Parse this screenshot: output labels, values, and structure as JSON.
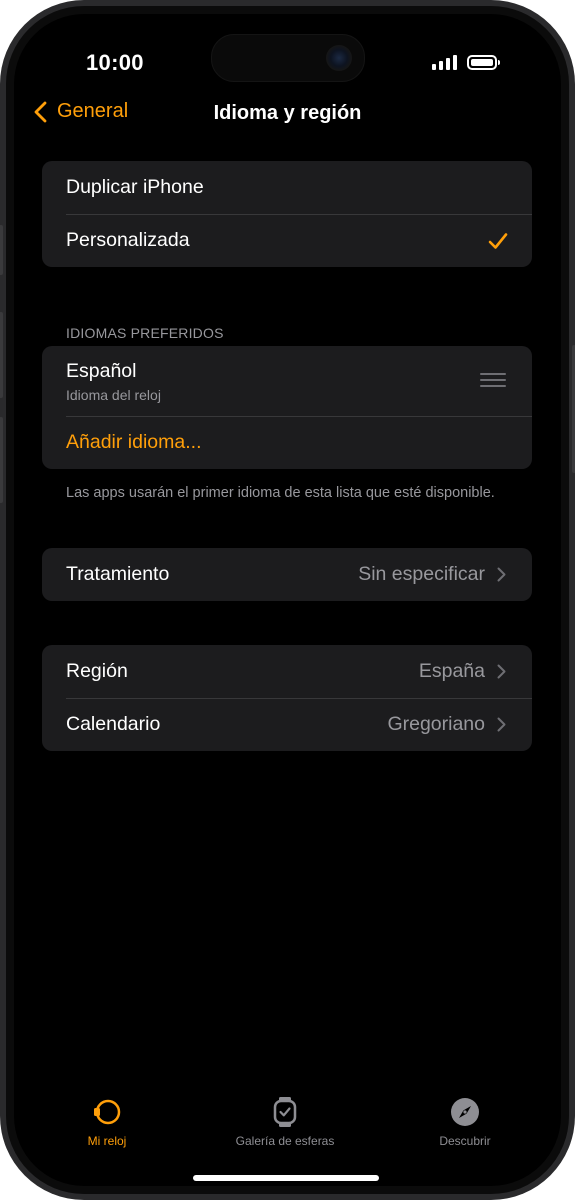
{
  "status_bar": {
    "time": "10:00"
  },
  "nav": {
    "back_label": "General",
    "title": "Idioma y región"
  },
  "language_mode": {
    "items": [
      {
        "label": "Duplicar iPhone",
        "selected": false
      },
      {
        "label": "Personalizada",
        "selected": true
      }
    ]
  },
  "preferred_languages": {
    "header": "IDIOMAS PREFERIDOS",
    "language": {
      "name": "Español",
      "subtitle": "Idioma del reloj"
    },
    "add_label": "Añadir idioma...",
    "footer": "Las apps usarán el primer idioma de esta lista que esté disponible."
  },
  "treatment": {
    "label": "Tratamiento",
    "value": "Sin especificar"
  },
  "region_group": {
    "region": {
      "label": "Región",
      "value": "España"
    },
    "calendar": {
      "label": "Calendario",
      "value": "Gregoriano"
    }
  },
  "tab_bar": {
    "tabs": [
      {
        "label": "Mi reloj",
        "icon": "watch-side-icon",
        "active": true
      },
      {
        "label": "Galería de esferas",
        "icon": "watch-face-icon",
        "active": false
      },
      {
        "label": "Descubrir",
        "icon": "compass-icon",
        "active": false
      }
    ]
  },
  "colors": {
    "accent": "#ff9f0a",
    "background": "#000000",
    "cell_background": "#1c1c1e",
    "secondary_text": "#98989d"
  }
}
